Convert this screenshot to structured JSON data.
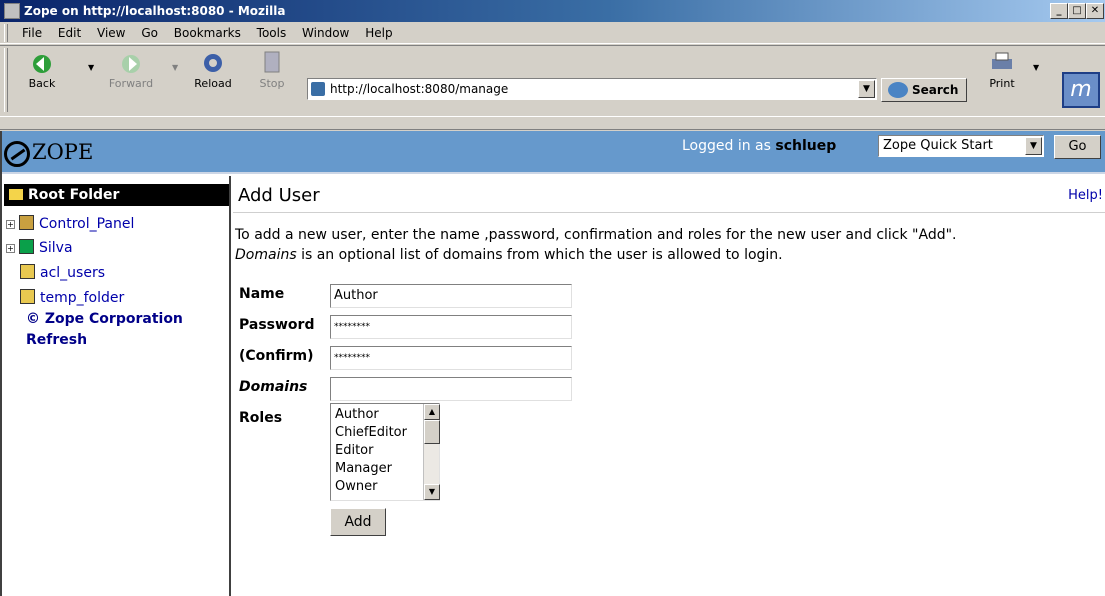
{
  "window": {
    "title": "Zope on http://localhost:8080 - Mozilla"
  },
  "menu": [
    "File",
    "Edit",
    "View",
    "Go",
    "Bookmarks",
    "Tools",
    "Window",
    "Help"
  ],
  "toolbar": {
    "back": "Back",
    "forward": "Forward",
    "reload": "Reload",
    "stop": "Stop",
    "url": "http://localhost:8080/manage",
    "search": "Search",
    "print": "Print"
  },
  "zope": {
    "logo": "ZOPE",
    "logged_prefix": "Logged in as",
    "user": "schluep",
    "quickstart": "Zope Quick Start",
    "go": "Go"
  },
  "tree": {
    "root": "Root Folder",
    "items": [
      {
        "label": "Control_Panel",
        "expand": "+"
      },
      {
        "label": "Silva",
        "expand": "+"
      },
      {
        "label": "acl_users",
        "expand": ""
      },
      {
        "label": "temp_folder",
        "expand": ""
      }
    ],
    "links": [
      "© Zope Corporation",
      "Refresh"
    ]
  },
  "page": {
    "title": "Add User",
    "help": "Help!",
    "intro_line1": "To add a new user, enter the name ,password, confirmation and roles for the new user and click \"Add\".",
    "intro_domains": "Domains",
    "intro_line2_rest": " is an optional list of domains from which the user is allowed to login."
  },
  "form": {
    "name_label": "Name",
    "name_value": "Author",
    "password_label": "Password",
    "password_value": "********",
    "confirm_label": "(Confirm)",
    "confirm_value": "********",
    "domains_label": "Domains",
    "domains_value": "",
    "roles_label": "Roles",
    "roles": [
      "Author",
      "ChiefEditor",
      "Editor",
      "Manager",
      "Owner"
    ],
    "add_label": "Add"
  },
  "colors": {
    "zope_bar": "#6699cc",
    "link": "#0000aa",
    "titlebar": "#0a246a"
  }
}
